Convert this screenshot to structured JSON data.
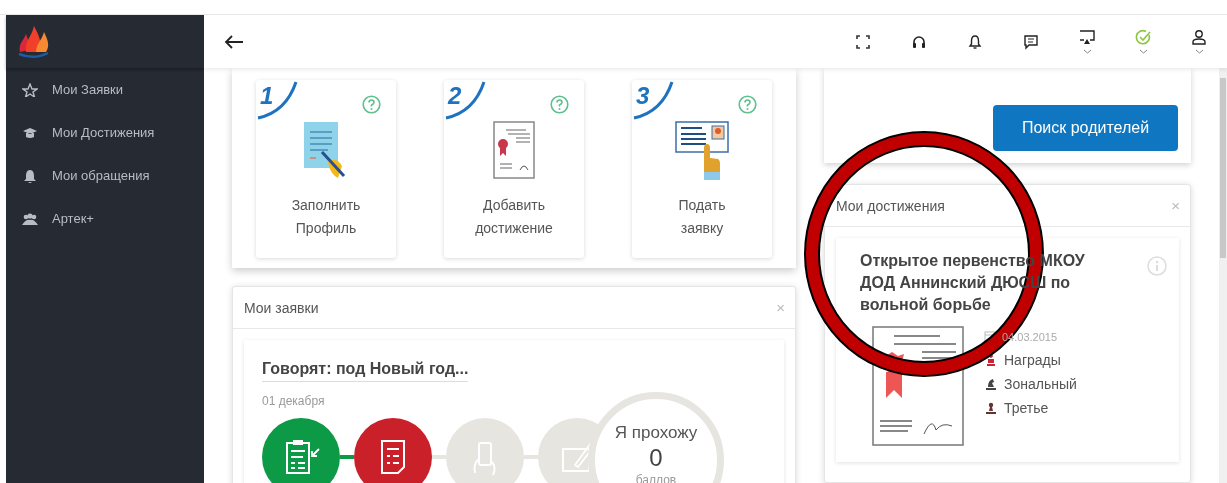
{
  "sidebar": {
    "items": [
      {
        "label": "Мои Заявки"
      },
      {
        "label": "Мои Достижения"
      },
      {
        "label": "Мои обращения"
      },
      {
        "label": "Артек+"
      }
    ]
  },
  "steps": [
    {
      "number": "1",
      "label": "Заполнить Профиль"
    },
    {
      "number": "2",
      "label": "Добавить достижение"
    },
    {
      "number": "3",
      "label": "Подать заявку"
    }
  ],
  "parents_button": "Поиск родителей",
  "applications": {
    "title": "Мои заявки",
    "close": "×",
    "item": {
      "title": "Говорят: под Новый год...",
      "date": "01 декабря",
      "stages": [
        {
          "done": true,
          "failed": false
        },
        {
          "done": false,
          "failed": true
        },
        {
          "done": false,
          "failed": false
        },
        {
          "done": false,
          "failed": false
        }
      ],
      "score_caption": "Я прохожу",
      "score": "0",
      "score_unit": "баллов"
    }
  },
  "achievements": {
    "title": "Мои достижения",
    "close": "×",
    "item": {
      "title": "Открытое первенство МКОУ ДОД Аннинский ДЮСШ по вольной борьбе",
      "date": "04.03.2015",
      "details": [
        {
          "text": "Награды"
        },
        {
          "text": "Зональный"
        },
        {
          "text": "Третье"
        }
      ]
    }
  }
}
